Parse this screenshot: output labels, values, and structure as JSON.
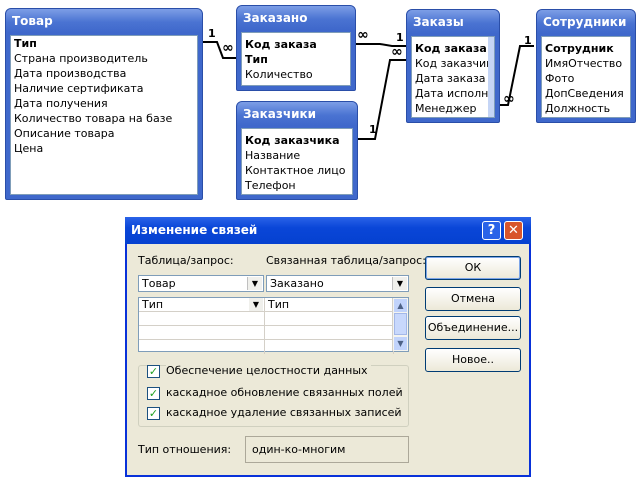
{
  "tables": {
    "tovar": {
      "title": "Товар",
      "fields": [
        "Тип",
        "Страна производитель",
        "Дата производства",
        "Наличие сертификата",
        "Дата получения",
        "Количество товара на базе",
        "Описание товара",
        "Цена"
      ]
    },
    "zakazano": {
      "title": "Заказано",
      "fields": [
        "Код заказа",
        "Тип",
        "Количество"
      ]
    },
    "zakazchiki": {
      "title": "Заказчики",
      "fields": [
        "Код заказчика",
        "Название",
        "Контактное лицо",
        "Телефон"
      ]
    },
    "zakazy": {
      "title": "Заказы",
      "fields": [
        "Код заказа",
        "Код заказчика",
        "Дата заказа",
        "Дата исполнени",
        "Менеджер"
      ]
    },
    "sotrudniki": {
      "title": "Сотрудники",
      "fields": [
        "Сотрудник",
        "ИмяОтчество",
        "Фото",
        "ДопСведения",
        "Должность"
      ]
    }
  },
  "relations": {
    "one": "1",
    "many": "∞"
  },
  "dialog": {
    "title": "Изменение связей",
    "help_label": "?",
    "close_label": "✕",
    "table_label": "Таблица/запрос:",
    "related_label": "Связанная таблица/запрос:",
    "table_value": "Товар",
    "related_value": "Заказано",
    "left_field": "Тип",
    "right_field": "Тип",
    "buttons": {
      "ok": "ОК",
      "cancel": "Отмена",
      "join": "Объединение...",
      "new": "Новое.."
    },
    "checks": {
      "integrity": "Обеспечение целостности данных",
      "cascade_update": "каскадное обновление связанных полей",
      "cascade_delete": "каскадное удаление связанных записей"
    },
    "reltype_label": "Тип отношения:",
    "reltype_value": "один-ко-многим"
  }
}
